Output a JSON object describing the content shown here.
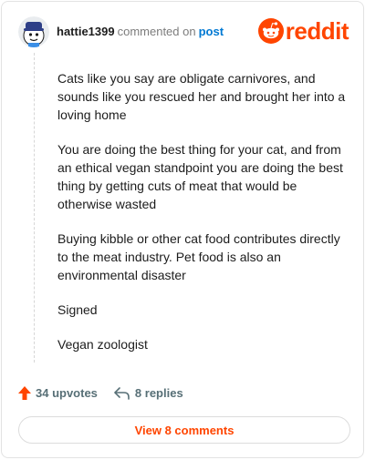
{
  "header": {
    "username": "hattie1399",
    "action_text": "commented on",
    "post_link": "post"
  },
  "brand": {
    "logo_text": "reddit",
    "accent_color": "#ff4500"
  },
  "comment": {
    "paragraphs": [
      "Cats like you say are obligate carnivores, and sounds like you rescued her and brought her into a loving home",
      "You are doing the best thing for your cat, and from an ethical vegan standpoint you are doing the best thing by getting cuts of meat that would be otherwise wasted",
      "Buying kibble or other cat food contributes directly to the meat industry. Pet food is also an environmental disaster",
      "Signed",
      "Vegan zoologist"
    ]
  },
  "actions": {
    "upvotes_label": "34 upvotes",
    "upvote_icon": "upvote-arrow-icon",
    "replies_label": "8 replies",
    "reply_icon": "reply-arrow-icon"
  },
  "footer": {
    "view_comments_label": "View 8 comments"
  }
}
